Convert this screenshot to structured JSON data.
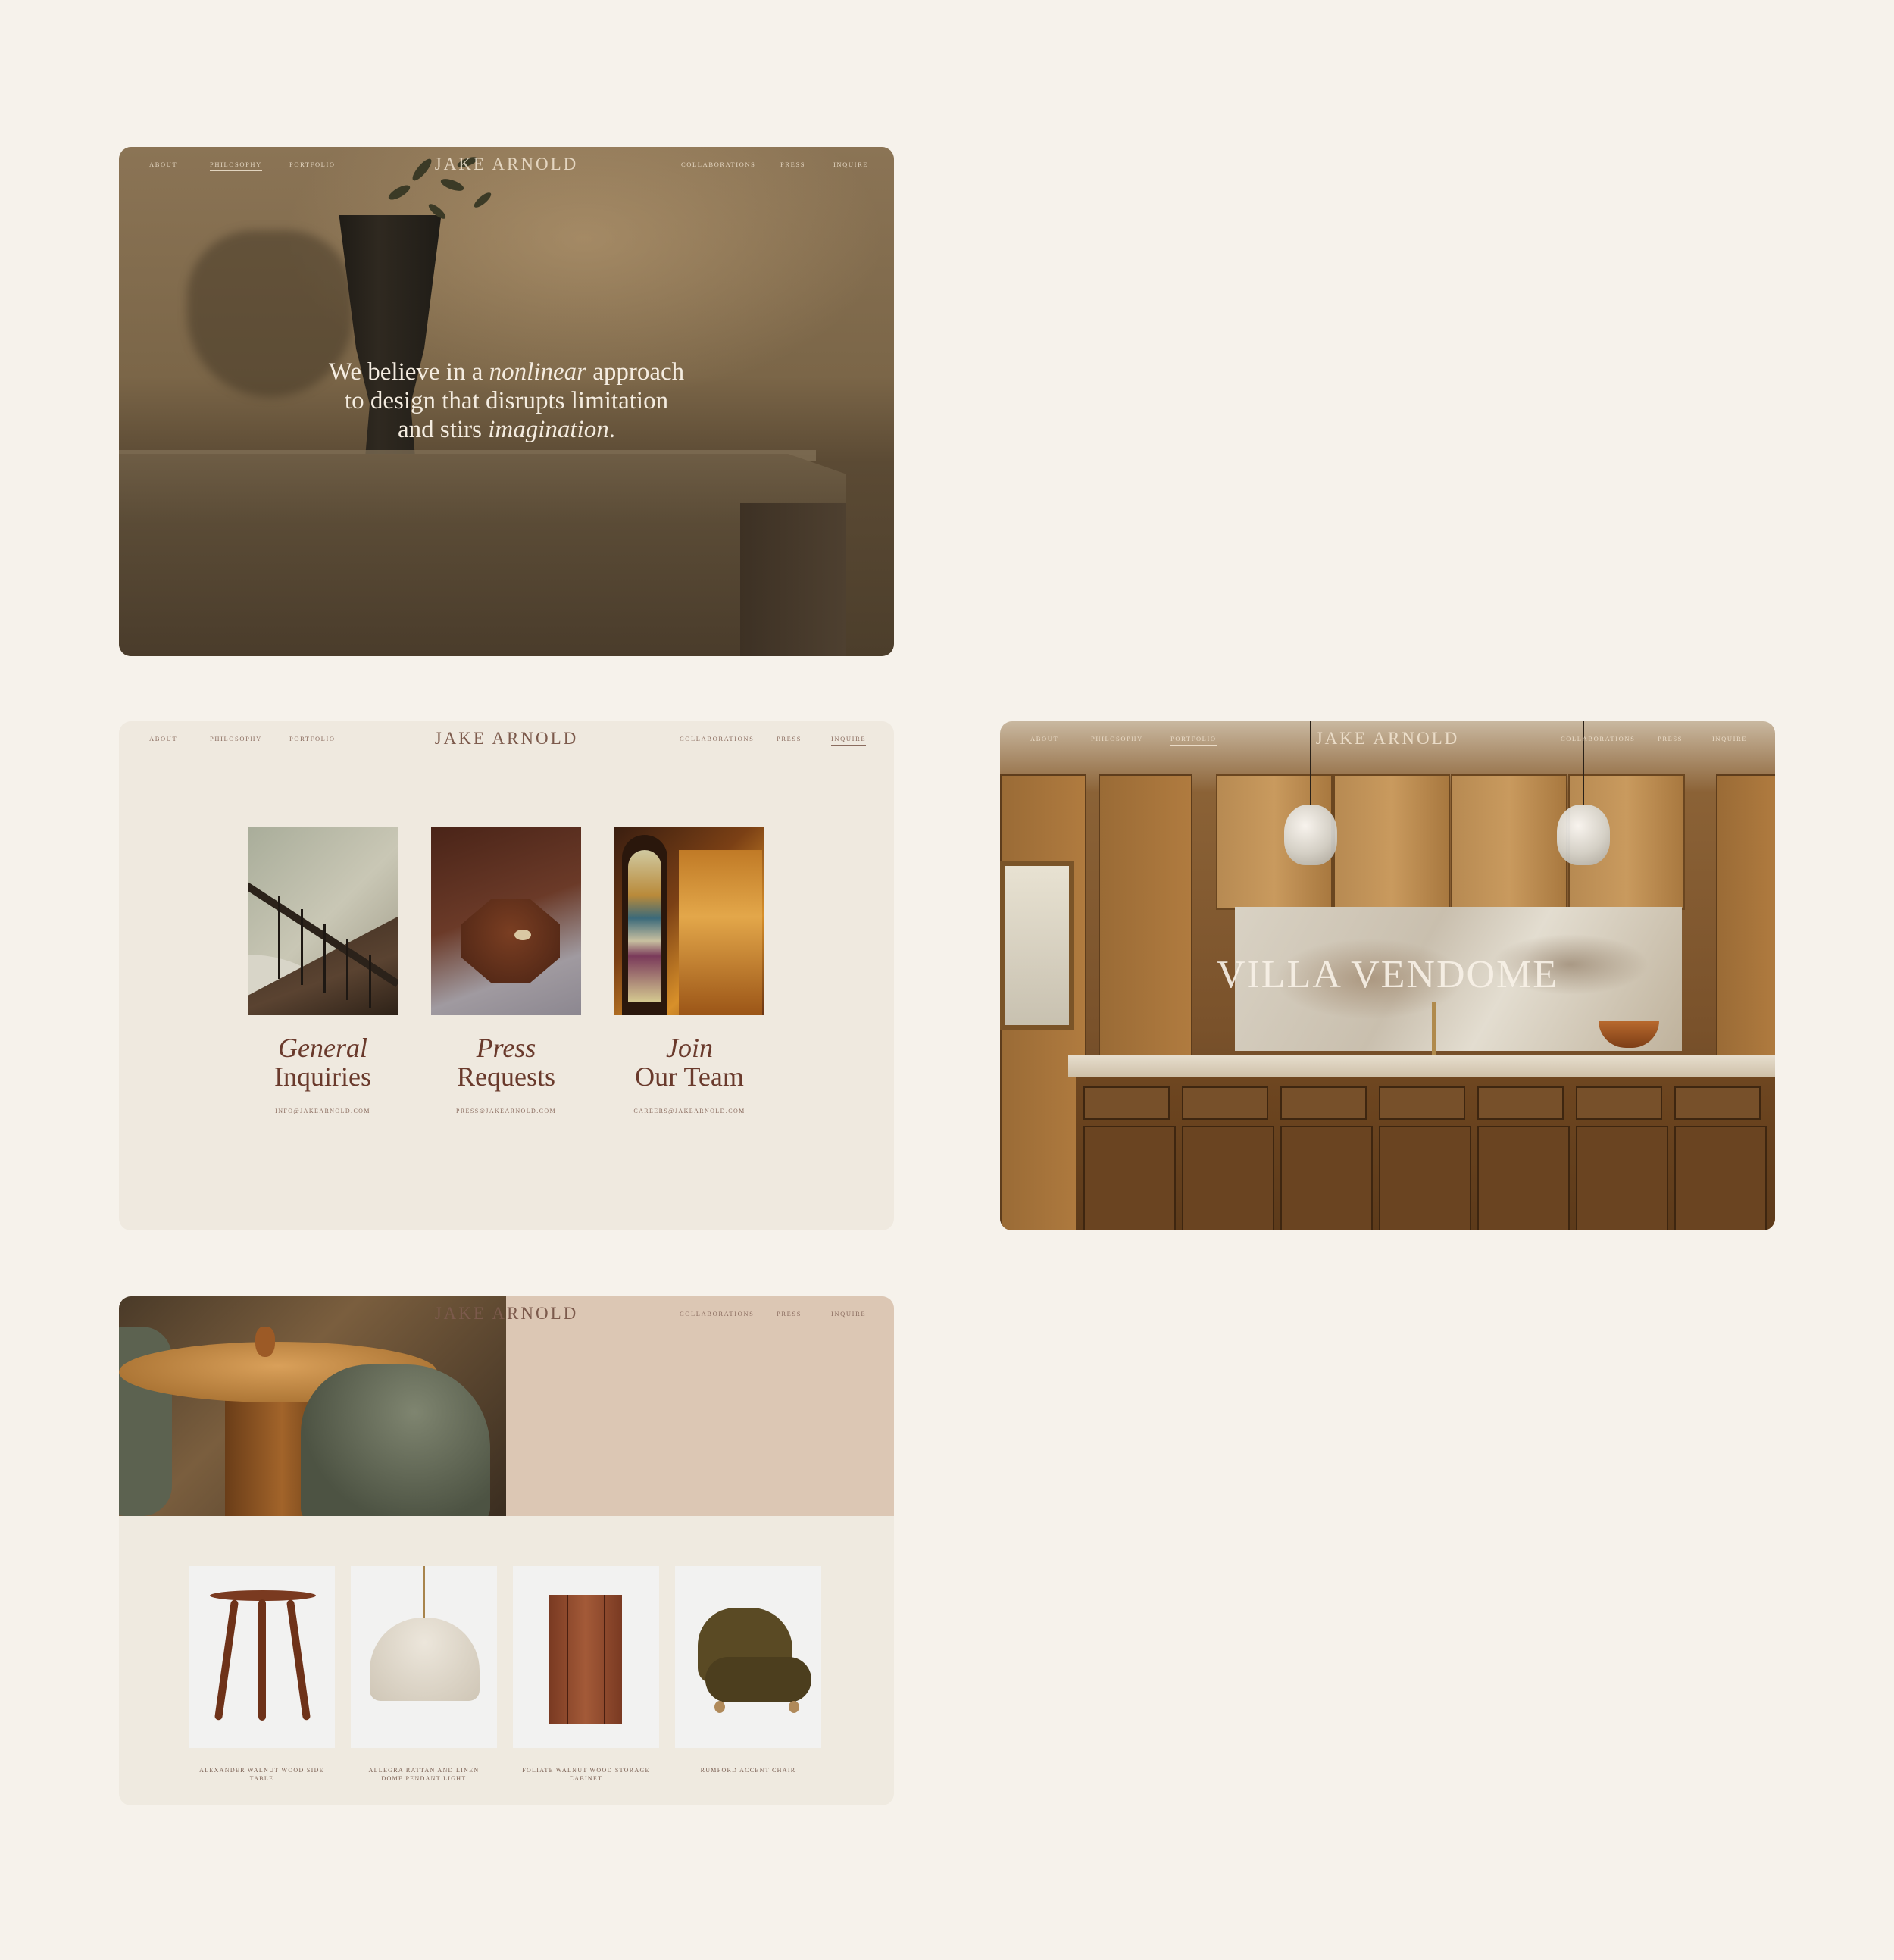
{
  "brand": "JAKE ARNOLD",
  "nav": {
    "left": [
      "About",
      "Philosophy",
      "Portfolio"
    ],
    "right": [
      "Collaborations",
      "Press",
      "Inquire"
    ]
  },
  "philosophy": {
    "active_nav": "Philosophy",
    "quote_line1_a": "We believe in a ",
    "quote_line1_em": "nonlinear",
    "quote_line1_b": " approach",
    "quote_line2": "to design that disrupts limitation",
    "quote_line3_a": "and stirs ",
    "quote_line3_em": "imagination",
    "quote_line3_b": "."
  },
  "inquire": {
    "active_nav": "Inquire",
    "contacts": [
      {
        "title_italic": "General",
        "title_roman": "Inquiries",
        "email": "info@jakearnold.com"
      },
      {
        "title_italic": "Press",
        "title_roman": "Requests",
        "email": "press@jakearnold.com"
      },
      {
        "title_italic": "Join",
        "title_roman": "Our Team",
        "email": "careers@jakearnold.com"
      }
    ]
  },
  "portfolio": {
    "active_nav": "Portfolio",
    "project_title": "VILLA VENDOME"
  },
  "shop": {
    "products": [
      {
        "name": "Alexander Walnut Wood Side Table"
      },
      {
        "name": "Allegra Rattan and Linen Dome Pendant Light"
      },
      {
        "name": "Foliate Walnut Wood Storage Cabinet"
      },
      {
        "name": "Rumford Accent Chair"
      }
    ]
  },
  "colors": {
    "page_bg": "#f6f2eb",
    "accent": "#6a3a2c",
    "card_light": "#efe9df",
    "shop_panel": "#dcc7b4"
  }
}
